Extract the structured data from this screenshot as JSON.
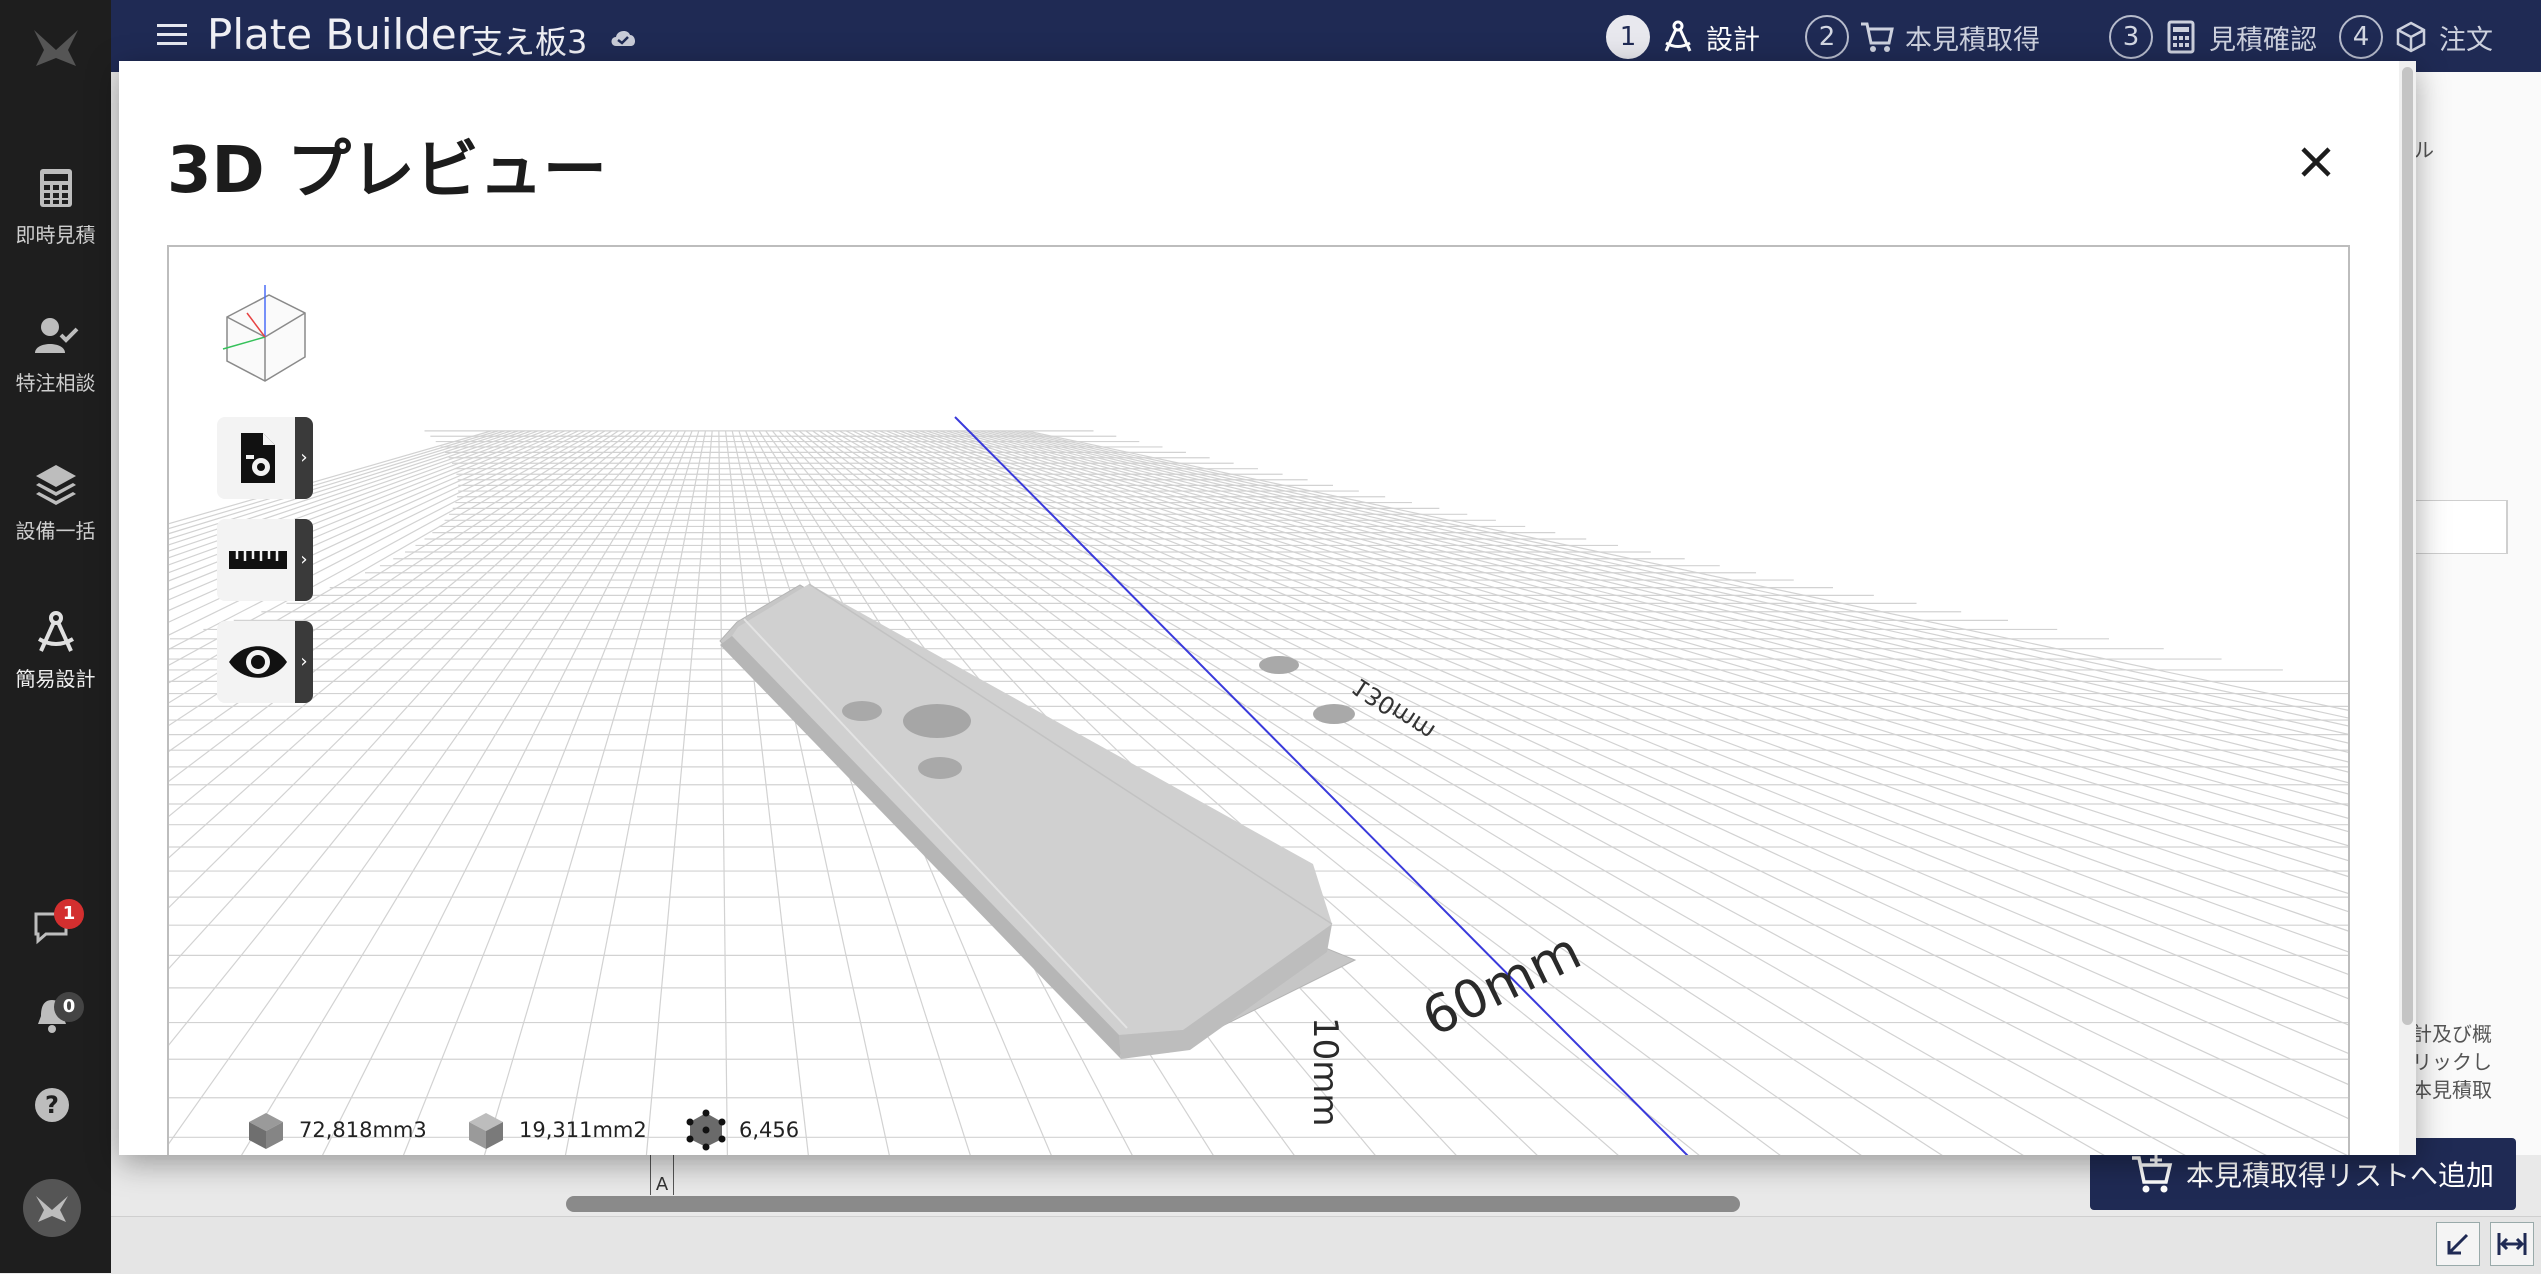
{
  "sidebar": {
    "items": [
      {
        "label": "即時見積",
        "icon": "calculator-icon"
      },
      {
        "label": "特注相談",
        "icon": "person-check-icon"
      },
      {
        "label": "設備一括",
        "icon": "layers-icon"
      },
      {
        "label": "簡易設計",
        "icon": "compass-draw-icon"
      }
    ],
    "chat_badge": "1",
    "notification_badge": "0"
  },
  "header": {
    "app_title": "Plate Builder",
    "project_name": "支え板3",
    "steps": [
      {
        "num": "1",
        "label": "設計"
      },
      {
        "num": "2",
        "label": "本見積取得"
      },
      {
        "num": "3",
        "label": "見積確認"
      },
      {
        "num": "4",
        "label": "注文"
      }
    ]
  },
  "background": {
    "right_fragment_top": "ル",
    "right_fragment_mid": "計及び概",
    "right_fragment_mid2": "リックし",
    "right_fragment_mid3": "本見積取",
    "ruler_label": "A",
    "add_button": "本見積取得リストへ追加"
  },
  "modal": {
    "title": "3D プレビュー",
    "dimension_labels": {
      "length": "130mm",
      "width": "60mm",
      "thickness": "10mm"
    },
    "stats": {
      "volume": "72,818mm3",
      "surface_area": "19,311mm2",
      "triangles": "6,456"
    }
  },
  "colors": {
    "sidebar_bg": "#1e1e1e",
    "header_bg": "#1f2a54",
    "plate_gray": "#c9c9c9",
    "axis_blue": "#3a3adb"
  }
}
